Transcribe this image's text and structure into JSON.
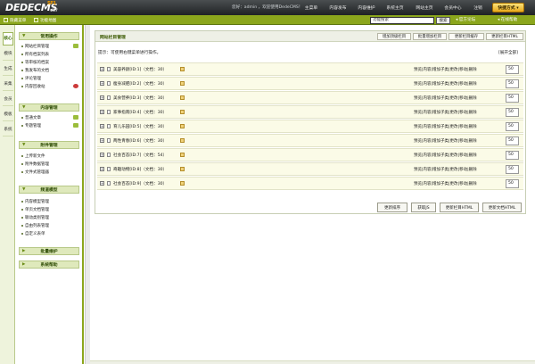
{
  "header": {
    "logo": "DEDECMS",
    "logo_sup": "SP1",
    "logo_version": "v5.7",
    "welcome": "您好：admin ，欢迎使用DedeCMS！",
    "nav": [
      "主菜单",
      "内容发布",
      "内容维护",
      "系统主页",
      "网站主页",
      "会员中心",
      "注销"
    ],
    "quick_button": "快捷方式 ▾"
  },
  "subbar": {
    "hide_menu": "隐藏菜单",
    "function_map": "功能地图",
    "search_placeholder": "功能搜索",
    "search_button": "搜索",
    "forum_link": "官方论坛",
    "help_link": "在线帮助"
  },
  "vtabs": [
    "核心",
    "模块",
    "生成",
    "采集",
    "会员",
    "模板",
    "系统"
  ],
  "sidebar": {
    "sections": [
      {
        "title": "常用操作",
        "items": [
          "网站栏目管理",
          "所有档案列表",
          "等审核的档案",
          "我发布的文档",
          "评论管理",
          "内容回收站"
        ]
      },
      {
        "title": "内容管理",
        "items": [
          "普通文章",
          "专题管理"
        ]
      },
      {
        "title": "附件管理",
        "items": [
          "上传新文件",
          "附件数据管理",
          "文件式管理器"
        ]
      },
      {
        "title": "频道模型",
        "items": [
          "内容模型管理",
          "单页文档管理",
          "联动类别管理",
          "自由列表管理",
          "自定义表单"
        ]
      },
      {
        "title": "批量维护",
        "items": []
      },
      {
        "title": "系统帮助",
        "items": []
      }
    ]
  },
  "main": {
    "title": "网站栏目管理",
    "buttons": [
      "增加顶级栏目",
      "批量增加栏目",
      "更新栏目缓存",
      "更新栏目HTML"
    ],
    "tip": "提示：可使用右键菜单进行操作。",
    "expand_all": "[展开全部]",
    "row_actions": "预览|内容|增加子类|更改|移动|删除",
    "rows": [
      {
        "name": "美容养颜[ID:1]（文档：30）",
        "order": "50"
      },
      {
        "name": "瘦身减肥[ID:2]（文档：30）",
        "order": "50"
      },
      {
        "name": "美食营养[ID:3]（文档：30）",
        "order": "50"
      },
      {
        "name": "家事指南[ID:4]（文档：30）",
        "order": "50"
      },
      {
        "name": "育儿乐园[ID:5]（文档：30）",
        "order": "50"
      },
      {
        "name": "两性青春[ID:6]（文档：30）",
        "order": "50"
      },
      {
        "name": "社会百态[ID:7]（文档：54）",
        "order": "50"
      },
      {
        "name": "奇趣动物[ID:8]（文档：30）",
        "order": "50"
      },
      {
        "name": "社会百态[ID:9]（文档：30）",
        "order": "50"
      }
    ],
    "footer_buttons": [
      "更新排序",
      "获取JS",
      "更新栏目HTML",
      "更新文档HTML"
    ]
  }
}
